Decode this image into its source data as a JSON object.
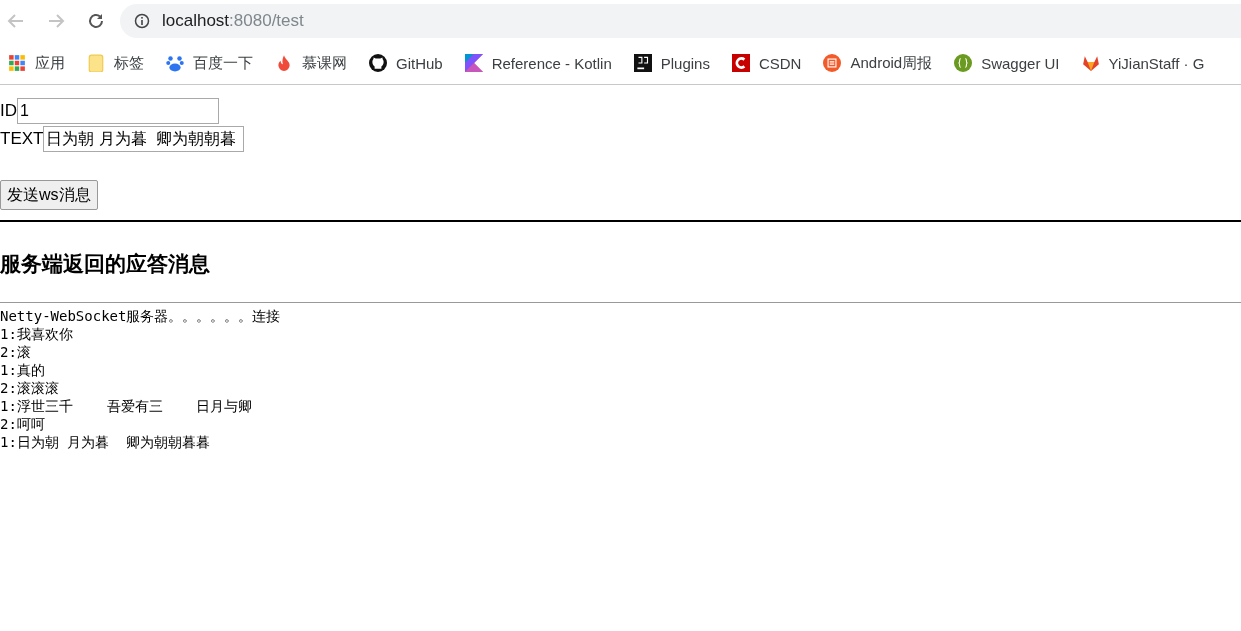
{
  "browser": {
    "address": {
      "host": "localhost",
      "path": ":8080/test"
    },
    "bookmarks": [
      {
        "label": "应用",
        "kind": "apps"
      },
      {
        "label": "标签",
        "kind": "folder"
      },
      {
        "label": "百度一下",
        "kind": "paw"
      },
      {
        "label": "慕课网",
        "kind": "flame"
      },
      {
        "label": "GitHub",
        "kind": "octocat"
      },
      {
        "label": "Reference - Kotlin",
        "kind": "kotlin"
      },
      {
        "label": "Plugins",
        "kind": "jb"
      },
      {
        "label": "CSDN",
        "kind": "csdn"
      },
      {
        "label": "Android周报",
        "kind": "news"
      },
      {
        "label": "Swagger UI",
        "kind": "swagger"
      },
      {
        "label": "YiJianStaff · G",
        "kind": "fox"
      }
    ]
  },
  "form": {
    "fields": [
      {
        "label": "ID",
        "value": "1"
      },
      {
        "label": "TEXT",
        "value": "日为朝 月为暮  卿为朝朝暮"
      }
    ],
    "button": "发送ws消息"
  },
  "heading": "服务端返回的应答消息",
  "messages": [
    "Netty-WebSocket服务器。。。。。。连接",
    "1:我喜欢你",
    "2:滚",
    "1:真的",
    "2:滚滚滚",
    "1:浮世三千    吾爱有三    日月与卿",
    "2:呵呵",
    "1:日为朝 月为暮  卿为朝朝暮暮"
  ]
}
